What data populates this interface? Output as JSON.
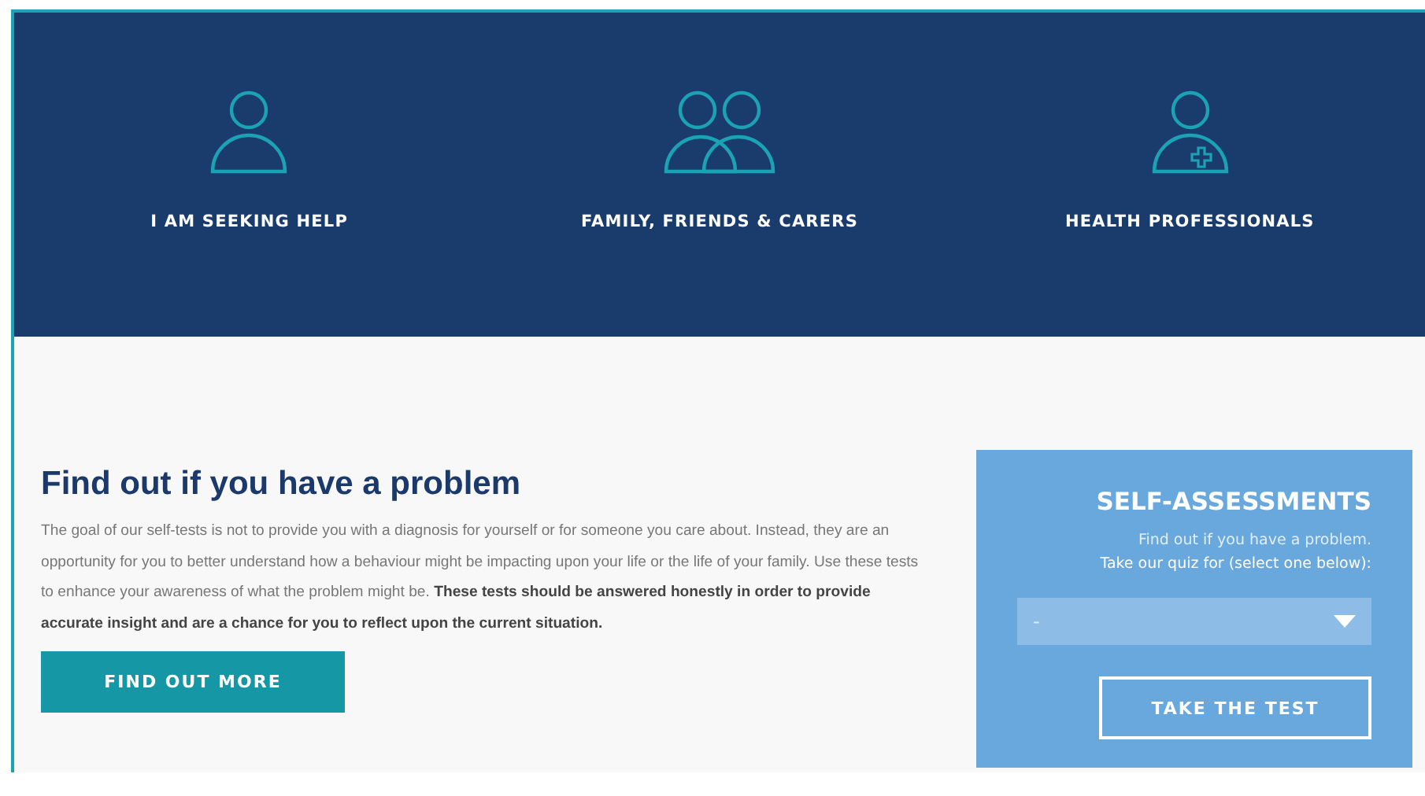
{
  "audiences": [
    {
      "kind": "person",
      "label": "I AM SEEKING HELP"
    },
    {
      "kind": "group",
      "label": "FAMILY, FRIENDS & CARERS"
    },
    {
      "kind": "professional",
      "label": "HEALTH PROFESSIONALS"
    }
  ],
  "intro": {
    "title": "Find out if you have a problem",
    "body": "The goal of our self-tests is not to provide you with a diagnosis for yourself or for someone you care about. Instead, they are an opportunity for you to better understand how a behaviour might be impacting upon your life or the life of your family. Use these tests to enhance your awareness of what the problem might be. **These tests should be answered honestly in order to provide accurate insight and are a chance for you to reflect upon the current situation.**",
    "button": "FIND OUT MORE"
  },
  "self_assessments": {
    "title": "SELF-ASSESSMENTS",
    "lines": [
      "Find out if you have a problem.",
      "Take our quiz for (select one below):"
    ],
    "select": {
      "value": "-"
    },
    "button": "TAKE THE TEST"
  }
}
